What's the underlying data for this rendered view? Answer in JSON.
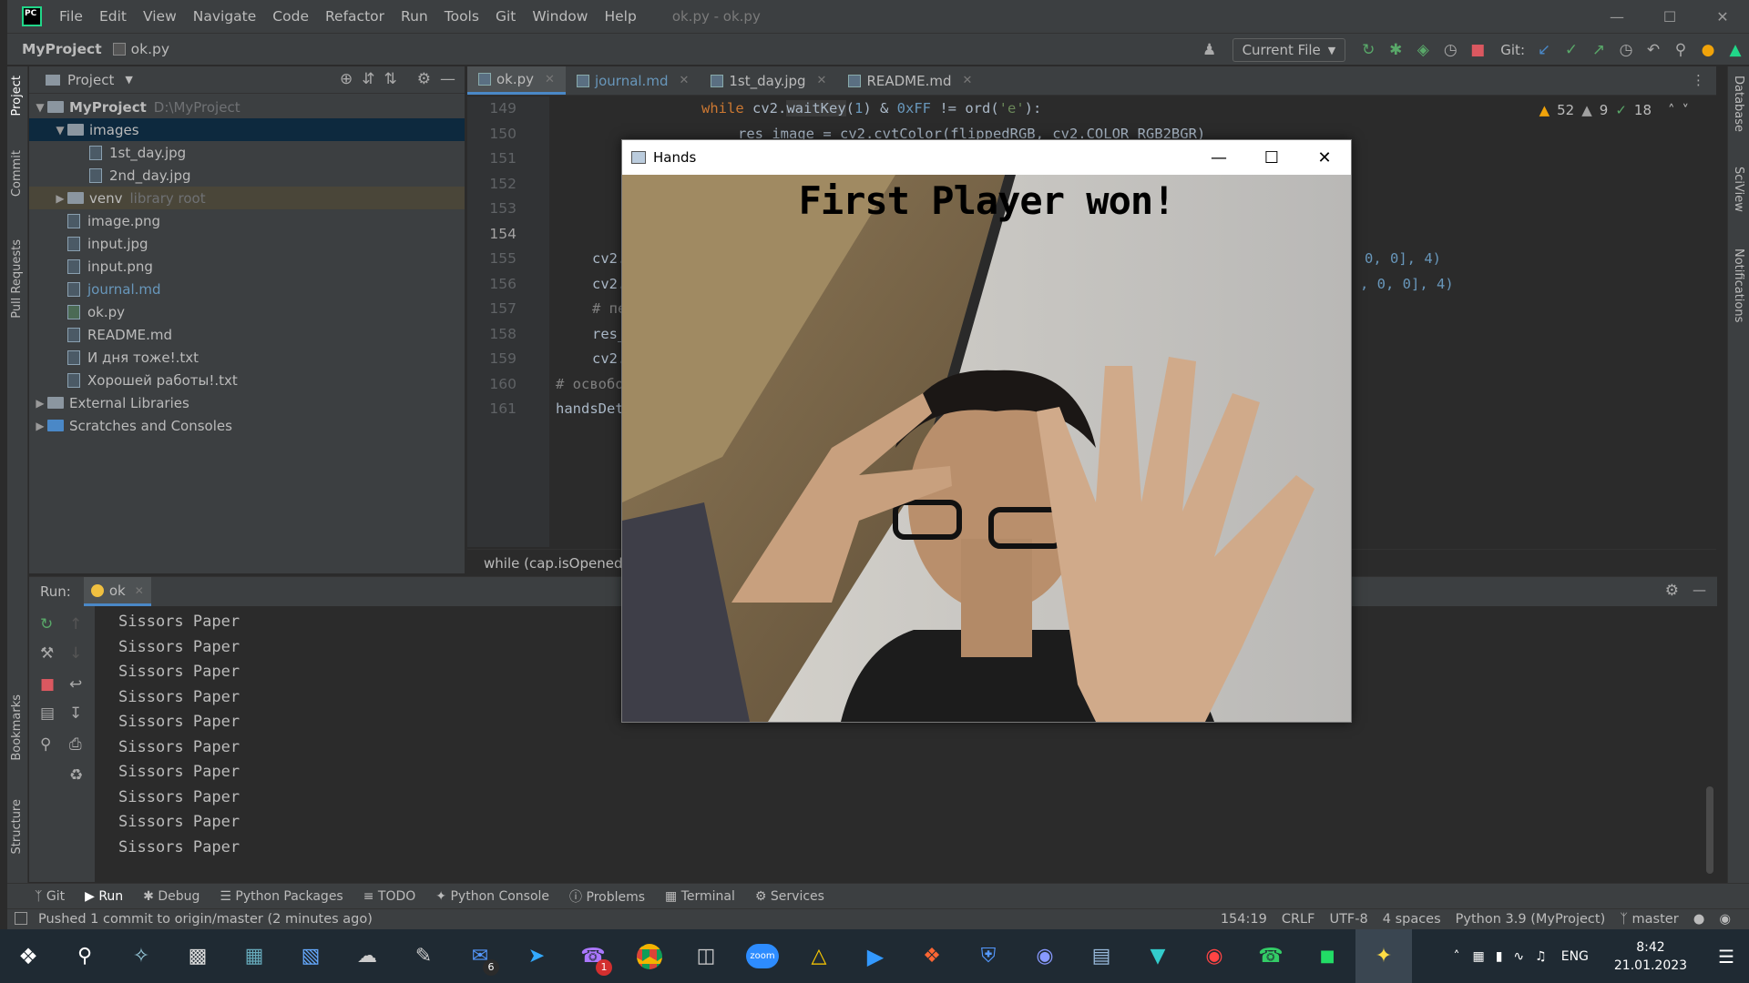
{
  "menubar": {
    "app_logo": "PC",
    "items": [
      "File",
      "Edit",
      "View",
      "Navigate",
      "Code",
      "Refactor",
      "Run",
      "Tools",
      "Git",
      "Window",
      "Help"
    ],
    "window_title": "ok.py - ok.py"
  },
  "navbar": {
    "project": "MyProject",
    "file": "ok.py",
    "run_config": "Current File",
    "git_label": "Git:"
  },
  "left_strip": [
    "Project",
    "Commit",
    "Pull Requests",
    "Bookmarks",
    "Structure"
  ],
  "right_strip": [
    "Database",
    "SciView",
    "Notifications"
  ],
  "project_panel": {
    "title": "Project",
    "tree": [
      {
        "label": "MyProject",
        "extra": "D:\\MyProject"
      },
      {
        "label": "images"
      },
      {
        "label": "1st_day.jpg"
      },
      {
        "label": "2nd_day.jpg"
      },
      {
        "label": "venv",
        "extra": "library root"
      },
      {
        "label": "image.png"
      },
      {
        "label": "input.jpg"
      },
      {
        "label": "input.png"
      },
      {
        "label": "journal.md"
      },
      {
        "label": "ok.py"
      },
      {
        "label": "README.md"
      },
      {
        "label": "И дня тоже!.txt"
      },
      {
        "label": "Хорошей работы!.txt"
      },
      {
        "label": "External Libraries"
      },
      {
        "label": "Scratches and Consoles"
      }
    ]
  },
  "editor": {
    "tabs": [
      "ok.py",
      "journal.md",
      "1st_day.jpg",
      "README.md"
    ],
    "line_numbers": [
      "149",
      "150",
      "151",
      "152",
      "153",
      "154",
      "155",
      "156",
      "157",
      "158",
      "159",
      "160",
      "161"
    ],
    "inspection": {
      "warnings": "52",
      "weak_warnings": "9",
      "typos": "18"
    },
    "line149": {
      "a": "while ",
      "b": "cv2.",
      "c": "waitKey",
      "d": "(",
      "e": "1",
      "f": ") & ",
      "g": "0xFF",
      "h": " != ",
      "i": "ord",
      "j": "(",
      "k": "'e'",
      "l": "):"
    },
    "line150": "res_image = cv2.cvtColor(flippedRGB, cv2.COLOR_RGB2BGR)",
    "line155": {
      "left": "cv2.",
      "right": "0, 0], 4)"
    },
    "line156": {
      "left": "cv2.",
      "right": ", 0, 0], 4)"
    },
    "line157": "# пе",
    "line158": "res_",
    "line159": "cv2.",
    "line160": "# освобо",
    "line161": "handsDet",
    "breadcrumb": "while (cap.isOpened())"
  },
  "run_panel": {
    "label": "Run:",
    "tab": "ok",
    "output": [
      "Sissors Paper",
      "Sissors Paper",
      "Sissors Paper",
      "Sissors Paper",
      "Sissors Paper",
      "Sissors Paper",
      "Sissors Paper",
      "Sissors Paper",
      "Sissors Paper",
      "Sissors Paper"
    ]
  },
  "tool_tabs": [
    "Git",
    "Run",
    "Debug",
    "Python Packages",
    "TODO",
    "Python Console",
    "Problems",
    "Terminal",
    "Services"
  ],
  "statusbar": {
    "message": "Pushed 1 commit to origin/master (2 minutes ago)",
    "position": "154:19",
    "line_sep": "CRLF",
    "encoding": "UTF-8",
    "indent": "4 spaces",
    "interpreter": "Python 3.9 (MyProject)",
    "branch": "master"
  },
  "hands_window": {
    "title": "Hands",
    "overlay_text": "First Player won!"
  },
  "taskbar": {
    "mail_badge": "6",
    "viber_badge": "1",
    "zoom_label": "zoom",
    "lang": "ENG",
    "time": "8:42",
    "date": "21.01.2023"
  },
  "colors": {
    "ide_bg": "#2b2b2b",
    "panel_bg": "#3c3f41",
    "accent": "#4a88c7",
    "keyword": "#cc7832",
    "number": "#6897bb",
    "string": "#6a8759"
  }
}
